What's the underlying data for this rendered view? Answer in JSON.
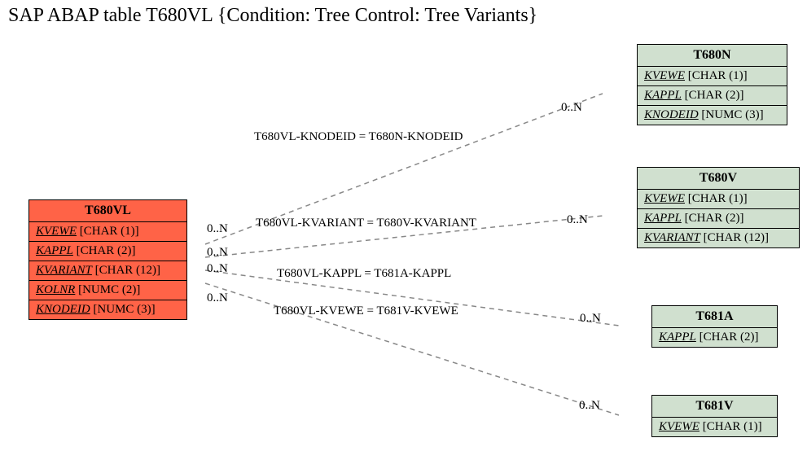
{
  "title": "SAP ABAP table T680VL {Condition: Tree Control: Tree Variants}",
  "main": {
    "name": "T680VL",
    "fields": [
      {
        "name": "KVEWE",
        "type": "[CHAR (1)]"
      },
      {
        "name": "KAPPL",
        "type": "[CHAR (2)]"
      },
      {
        "name": "KVARIANT",
        "type": "[CHAR (12)]"
      },
      {
        "name": "KOLNR",
        "type": "[NUMC (2)]"
      },
      {
        "name": "KNODEID",
        "type": "[NUMC (3)]"
      }
    ]
  },
  "related": [
    {
      "name": "T680N",
      "fields": [
        {
          "name": "KVEWE",
          "type": "[CHAR (1)]"
        },
        {
          "name": "KAPPL",
          "type": "[CHAR (2)]"
        },
        {
          "name": "KNODEID",
          "type": "[NUMC (3)]"
        }
      ]
    },
    {
      "name": "T680V",
      "fields": [
        {
          "name": "KVEWE",
          "type": "[CHAR (1)]"
        },
        {
          "name": "KAPPL",
          "type": "[CHAR (2)]"
        },
        {
          "name": "KVARIANT",
          "type": "[CHAR (12)]"
        }
      ]
    },
    {
      "name": "T681A",
      "fields": [
        {
          "name": "KAPPL",
          "type": "[CHAR (2)]"
        }
      ]
    },
    {
      "name": "T681V",
      "fields": [
        {
          "name": "KVEWE",
          "type": "[CHAR (1)]"
        }
      ]
    }
  ],
  "relations": [
    {
      "label": "T680VL-KNODEID = T680N-KNODEID",
      "leftCard": "0..N",
      "rightCard": "0..N"
    },
    {
      "label": "T680VL-KVARIANT = T680V-KVARIANT",
      "leftCard": "0..N",
      "rightCard": "0..N"
    },
    {
      "label": "T680VL-KAPPL = T681A-KAPPL",
      "leftCard": "0..N",
      "rightCard": "0..N"
    },
    {
      "label": "T680VL-KVEWE = T681V-KVEWE",
      "leftCard": "0..N",
      "rightCard": "0..N"
    }
  ]
}
